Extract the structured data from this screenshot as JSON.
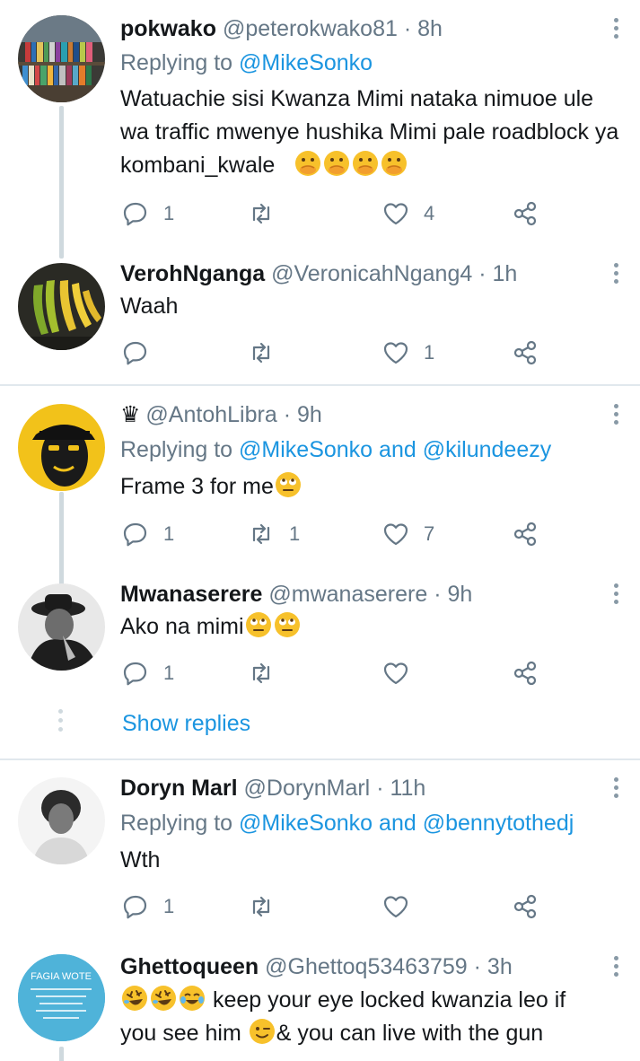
{
  "colors": {
    "accent": "#1b95e0",
    "secondary_text": "#657786",
    "divider": "#e1e8ed",
    "thread_line": "#cfd9de"
  },
  "tweets": [
    {
      "name": "pokwako",
      "handle": "@peterokwako81",
      "separator": "·",
      "time": "8h",
      "replying_prefix": "Replying to",
      "mentions": [
        "@MikeSonko"
      ],
      "text": "Watuachie sisi Kwanza Mimi nataka  nimuoe ule wa traffic mwenye hushika Mimi pale roadblock ya  kombani_kwale",
      "emoji": [
        "face-with-hand-over-mouth",
        "face-with-hand-over-mouth",
        "face-with-hand-over-mouth",
        "face-with-hand-over-mouth"
      ],
      "reply_count": "1",
      "retweet_count": "",
      "like_count": "4"
    },
    {
      "name": "VerohNganga",
      "handle": "@VeronicahNgang4",
      "separator": "·",
      "time": "1h",
      "text": "Waah",
      "reply_count": "",
      "retweet_count": "",
      "like_count": "1"
    },
    {
      "name": "",
      "crown_icon": "chess-king-icon",
      "crown_glyph": "♛",
      "handle": "@AntohLibra",
      "separator": "·",
      "time": "9h",
      "replying_prefix": "Replying to",
      "mentions": [
        "@MikeSonko",
        "@kilundeezy"
      ],
      "mention_joiner": "and",
      "text": "Frame 3 for me",
      "emoji": [
        "face-with-rolling-eyes"
      ],
      "reply_count": "1",
      "retweet_count": "1",
      "like_count": "7"
    },
    {
      "name": "Mwanaserere",
      "handle": "@mwanaserere",
      "separator": "·",
      "time": "9h",
      "text": "Ako na mimi",
      "emoji": [
        "face-with-rolling-eyes",
        "face-with-rolling-eyes"
      ],
      "reply_count": "1",
      "retweet_count": "",
      "like_count": "",
      "show_replies": "Show replies"
    },
    {
      "name": "Doryn Marl",
      "handle": "@DorynMarl",
      "separator": "·",
      "time": "11h",
      "replying_prefix": "Replying to",
      "mentions": [
        "@MikeSonko",
        "@bennytothedj"
      ],
      "mention_joiner": "and",
      "text": "Wth",
      "reply_count": "1",
      "retweet_count": "",
      "like_count": ""
    },
    {
      "name": "Ghettoqueen",
      "handle": "@Ghettoq53463759",
      "separator": "·",
      "time": "3h",
      "emoji_lead": [
        "rolling-on-floor-laughing",
        "rolling-on-floor-laughing",
        "face-with-tears-of-joy"
      ],
      "text_1": "keep your eye locked kwanzia leo if",
      "text_2_a": "you see him",
      "emoji_mid": [
        "winking-face"
      ],
      "text_2_b": "& you can live with the gun",
      "avatar_text": "FAGIA WOTE"
    }
  ]
}
